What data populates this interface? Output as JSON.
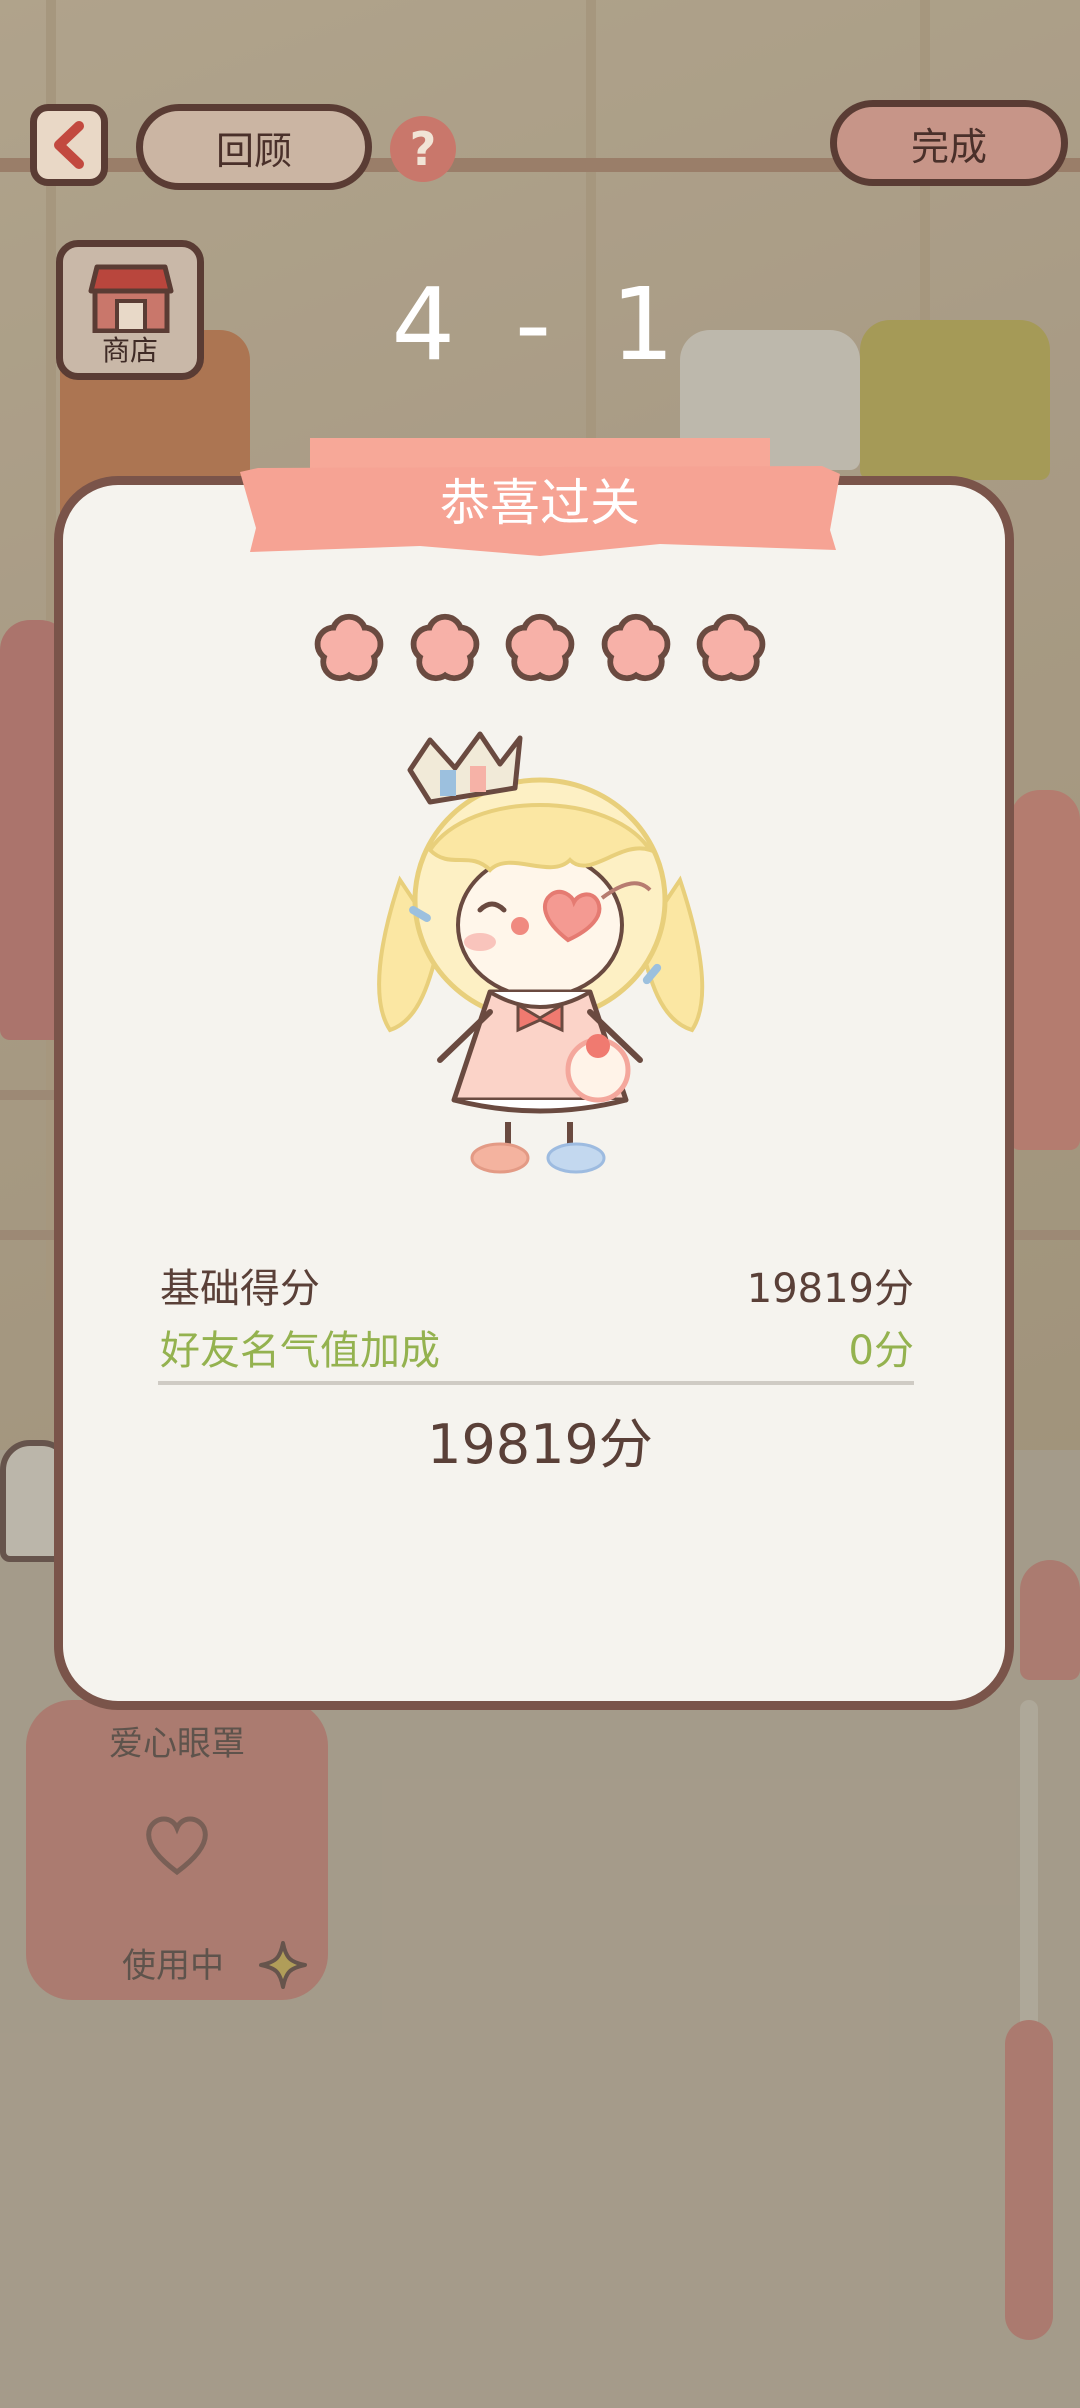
{
  "topbar": {
    "review_label": "回顾",
    "help_glyph": "?",
    "done_label": "完成",
    "back_icon": "chevron-left-icon"
  },
  "shop": {
    "label": "商店",
    "icon": "storefront-icon"
  },
  "level": {
    "title": "4 - 1"
  },
  "result": {
    "banner": "恭喜过关",
    "stars_earned": 5,
    "stars_total": 5,
    "base_label": "基础得分",
    "base_value": "19819分",
    "bonus_label": "好友名气值加成",
    "bonus_value": "0分",
    "total_value": "19819分"
  },
  "item_card": {
    "name": "爱心眼罩",
    "status": "使用中"
  },
  "colors": {
    "accent": "#f4a595",
    "star_fill": "#f7b1a8",
    "bonus_green": "#94b24f",
    "outline": "#5a3c34"
  }
}
